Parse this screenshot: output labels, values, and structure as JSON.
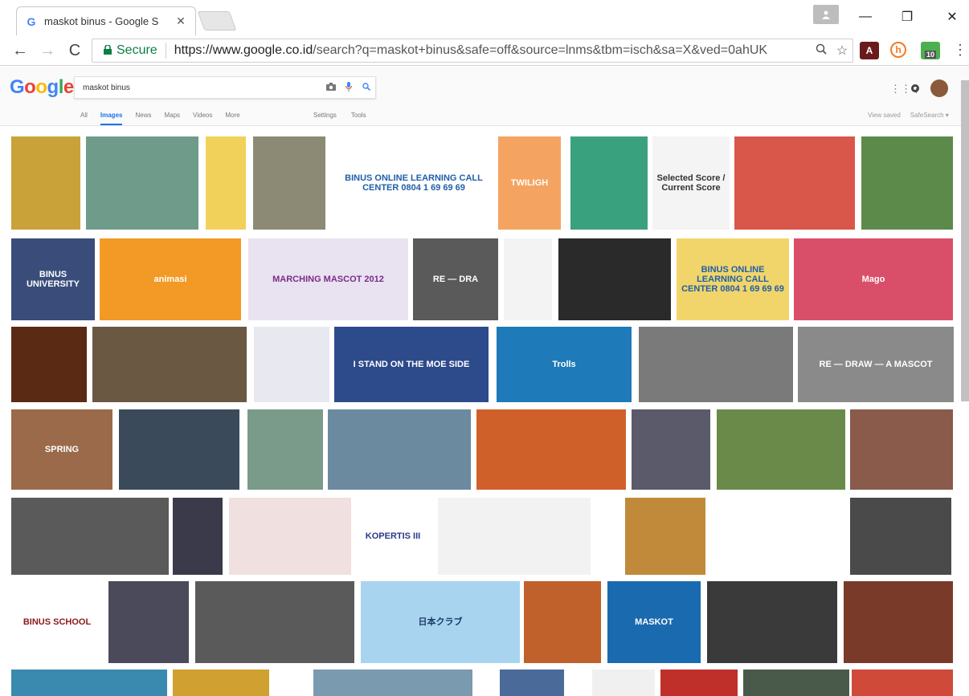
{
  "browser": {
    "tab_title": "maskot binus - Google S",
    "tab_favicon": "G",
    "tab_close": "✕",
    "window_controls": {
      "minimize": "—",
      "maximize": "❐",
      "close": "✕"
    },
    "nav": {
      "back": "←",
      "forward": "→",
      "reload": "C"
    },
    "secure_label": "Secure",
    "url_host": "https://www.google.co.id",
    "url_path": "/search?q=maskot+binus&safe=off&source=lnms&tbm=isch&sa=X&ved=0ahUK",
    "extension_badge": "10"
  },
  "google": {
    "logo": [
      "G",
      "o",
      "o",
      "g",
      "l",
      "e"
    ],
    "query": "maskot binus",
    "tabs": [
      "All",
      "Images",
      "News",
      "Maps",
      "Videos",
      "More"
    ],
    "active_tab": "Images",
    "tools": [
      "Settings",
      "Tools"
    ],
    "right_links": [
      "View saved",
      "SafeSearch ▾"
    ]
  },
  "images": [
    {
      "label": "",
      "color": "#c9a23a"
    },
    {
      "label": "",
      "color": "#6f9b8a"
    },
    {
      "label": "",
      "color": "#f2d15a"
    },
    {
      "label": "",
      "color": "#8c8a74"
    },
    {
      "label": "BINUS ONLINE LEARNING CALL CENTER 0804 1 69 69 69",
      "color": "#ffffff",
      "text_color": "#1f5fa8"
    },
    {
      "label": "TWILIGH",
      "color": "#f4a460"
    },
    {
      "label": "",
      "color": "#3aa17e"
    },
    {
      "label": "Selected Score / Current Score",
      "color": "#f4f4f4",
      "text_color": "#333"
    },
    {
      "label": "",
      "color": "#d9574a"
    },
    {
      "label": "",
      "color": "#5c8a4a"
    },
    {
      "label": "BINUS UNIVERSITY",
      "color": "#3a4d7a"
    },
    {
      "label": "animasi",
      "color": "#f29a25"
    },
    {
      "label": "MARCHING MASCOT 2012",
      "color": "#e9e2f0",
      "text_color": "#7a2c8a"
    },
    {
      "label": "RE — DRA",
      "color": "#5a5a5a"
    },
    {
      "label": "",
      "color": "#f3f3f3"
    },
    {
      "label": "",
      "color": "#2a2a2a"
    },
    {
      "label": "BINUS ONLINE LEARNING CALL CENTER 0804 1 69 69 69",
      "color": "#f1d56a",
      "text_color": "#1f5fa8"
    },
    {
      "label": "Mago",
      "color": "#d94f6a"
    },
    {
      "label": "",
      "color": "#5a2a14"
    },
    {
      "label": "",
      "color": "#6b5842"
    },
    {
      "label": "",
      "color": "#e8e8f0"
    },
    {
      "label": "I STAND ON THE MOE SIDE",
      "color": "#2d4a8a"
    },
    {
      "label": "Trolls",
      "color": "#1e7ab8"
    },
    {
      "label": "",
      "color": "#7a7a7a"
    },
    {
      "label": "RE — DRAW — A MASCOT",
      "color": "#8a8a8a"
    },
    {
      "label": "SPRING",
      "color": "#9a6a4a"
    },
    {
      "label": "",
      "color": "#3a4a5a"
    },
    {
      "label": "",
      "color": "#7a9a8a"
    },
    {
      "label": "",
      "color": "#6b8aa0"
    },
    {
      "label": "",
      "color": "#d0602a"
    },
    {
      "label": "",
      "color": "#5a5a6a"
    },
    {
      "label": "",
      "color": "#6a8a4a"
    },
    {
      "label": "",
      "color": "#8a5a4a"
    },
    {
      "label": "",
      "color": "#5a5a5a"
    },
    {
      "label": "",
      "color": "#3a3a4a"
    },
    {
      "label": "",
      "color": "#f0e0e0"
    },
    {
      "label": "KOPERTIS III",
      "color": "#ffffff",
      "text_color": "#2a3a8a"
    },
    {
      "label": "",
      "color": "#f2f2f2"
    },
    {
      "label": "",
      "color": "#c08a3a"
    },
    {
      "label": "",
      "color": "#ffffff"
    },
    {
      "label": "",
      "color": "#4a4a4a"
    },
    {
      "label": "BINUS SCHOOL",
      "color": "#ffffff",
      "text_color": "#8a1a1a"
    },
    {
      "label": "",
      "color": "#4a4a5a"
    },
    {
      "label": "",
      "color": "#5a5a5a"
    },
    {
      "label": "日本クラブ",
      "color": "#a8d4f0",
      "text_color": "#1a3a6a"
    },
    {
      "label": "",
      "color": "#c0602a"
    },
    {
      "label": "MASKOT",
      "color": "#1a6ab0"
    },
    {
      "label": "",
      "color": "#3a3a3a"
    },
    {
      "label": "",
      "color": "#7a3a2a"
    },
    {
      "label": "",
      "color": "#3a8ab0"
    },
    {
      "label": "",
      "color": "#d0a030"
    },
    {
      "label": "",
      "color": "#7a9ab0"
    },
    {
      "label": "",
      "color": "#4a6a9a"
    },
    {
      "label": "",
      "color": "#f0f0f0"
    },
    {
      "label": "",
      "color": "#c0302a"
    },
    {
      "label": "",
      "color": "#4a5a4a"
    },
    {
      "label": "",
      "color": "#d04a3a"
    },
    {
      "label": "",
      "color": "#f5f5ff"
    }
  ]
}
